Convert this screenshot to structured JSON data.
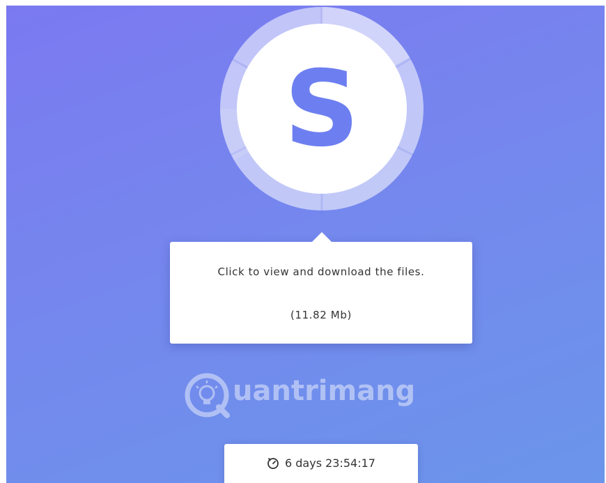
{
  "logo": {
    "letter": "S",
    "icon": "s-logo-icon",
    "accent": "#6d7ff0"
  },
  "download_tooltip": {
    "message": "Click to view and download the files.",
    "size": "(11.82 Mb)"
  },
  "watermark": {
    "text": "uantrimang",
    "icon": "lightbulb-q-icon"
  },
  "timer": {
    "icon": "stopwatch-icon",
    "value": "6 days 23:54:17"
  },
  "colors": {
    "background_start": "#7b79f0",
    "background_end": "#6b95ea",
    "card": "#ffffff",
    "text": "#333333"
  }
}
